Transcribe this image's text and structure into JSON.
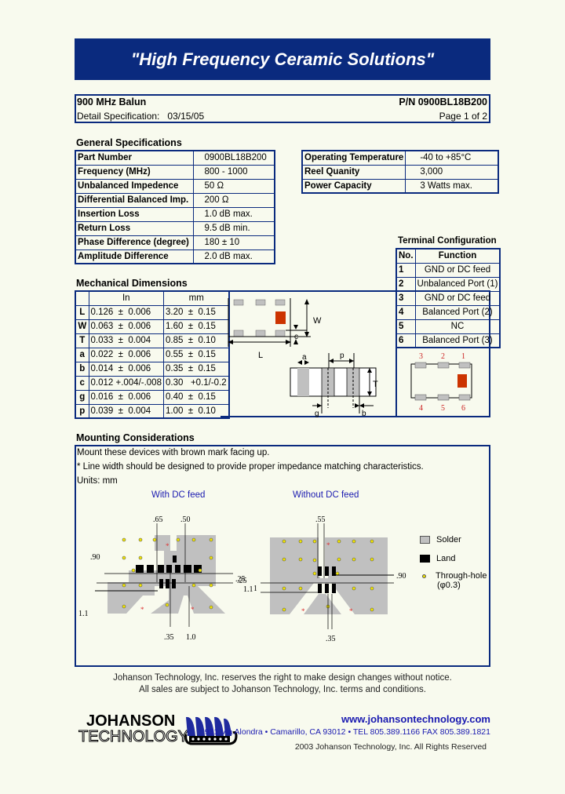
{
  "banner": {
    "title": "\"High Frequency Ceramic Solutions\""
  },
  "header": {
    "product": "900 MHz Balun",
    "part_number": "P/N 0900BL18B200",
    "spec_label": "Detail Specification:",
    "spec_date": "03/15/05",
    "page": "Page 1 of 2"
  },
  "general_specs": {
    "title": "General Specifications",
    "rows": [
      {
        "k": "Part Number",
        "v": "0900BL18B200"
      },
      {
        "k": "Frequency (MHz)",
        "v": "800 - 1000"
      },
      {
        "k": "Unbalanced Impedence",
        "v": "50 Ω"
      },
      {
        "k": "Differential Balanced Imp.",
        "v": "200 Ω"
      },
      {
        "k": "Insertion Loss",
        "v": "1.0 dB max."
      },
      {
        "k": "Return Loss",
        "v": "9.5 dB min."
      },
      {
        "k": "Phase Difference (degree)",
        "v": "180 ± 10"
      },
      {
        "k": "Amplitude Difference",
        "v": "2.0 dB max."
      }
    ],
    "other_rows": [
      {
        "k": "Operating Temperature",
        "v": "-40 to +85°C"
      },
      {
        "k": "Reel Quanity",
        "v": "3,000"
      },
      {
        "k": "Power Capacity",
        "v": "3 Watts max."
      }
    ]
  },
  "mechanical": {
    "title": "Mechanical Dimensions",
    "col_in": "In",
    "col_mm": "mm",
    "rows": [
      {
        "l": "L",
        "in": "0.126  ±  0.006",
        "mm": "3.20  ±  0.15"
      },
      {
        "l": "W",
        "in": "0.063  ±  0.006",
        "mm": "1.60  ±  0.15"
      },
      {
        "l": "T",
        "in": "0.033  ±  0.004",
        "mm": "0.85  ±  0.10"
      },
      {
        "l": "a",
        "in": "0.022  ±  0.006",
        "mm": "0.55  ±  0.15"
      },
      {
        "l": "b",
        "in": "0.014  ±  0.006",
        "mm": "0.35  ±  0.15"
      },
      {
        "l": "c",
        "in": "0.012 +.004/-.008",
        "mm": "0.30   +0.1/-0.2"
      },
      {
        "l": "g",
        "in": "0.016  ±  0.006",
        "mm": "0.40  ±  0.15"
      },
      {
        "l": "p",
        "in": "0.039  ±  0.004",
        "mm": "1.00  ±  0.10"
      }
    ],
    "diagram_labels": {
      "W": "W",
      "c": "c",
      "L": "L",
      "a": "a",
      "p": "p",
      "T": "T",
      "g": "g",
      "b": "b"
    }
  },
  "terminal": {
    "title": "Terminal Configuration",
    "col_no": "No.",
    "col_fn": "Function",
    "rows": [
      {
        "no": "1",
        "fn": "GND or DC feed"
      },
      {
        "no": "2",
        "fn": "Unbalanced Port (1)"
      },
      {
        "no": "3",
        "fn": "GND or DC feed"
      },
      {
        "no": "4",
        "fn": "Balanced Port (2)"
      },
      {
        "no": "5",
        "fn": "NC"
      },
      {
        "no": "6",
        "fn": "Balanced Port (3)"
      }
    ],
    "pin_top": [
      "3",
      "2",
      "1"
    ],
    "pin_bottom": [
      "4",
      "5",
      "6"
    ]
  },
  "mounting": {
    "title": "Mounting Considerations",
    "lines": [
      "Mount these devices with brown mark facing up.",
      "* Line width should be designed to provide proper impedance matching characteristics.",
      "Units: mm"
    ],
    "with_dc": "With DC feed",
    "without_dc": "Without DC feed",
    "dims_with": {
      "d065": ".65",
      "d050": ".50",
      "d090": ".90",
      "d025": ".25",
      "d11a": "1.1",
      "d11b": "1.1",
      "d035": ".35",
      "d10": "1.0"
    },
    "dims_without": {
      "d065": ".55",
      "d025": ".25",
      "d11": "1.1",
      "d090": ".90",
      "d035": ".35"
    },
    "legend": {
      "solder": "Solder",
      "land": "Land",
      "through": "Through-hole",
      "through2": "(φ0.3)"
    }
  },
  "footer": {
    "line1": "Johanson Technology, Inc. reserves the right to make design changes without notice.",
    "line2": "All sales are subject to Johanson Technology, Inc. terms and conditions.",
    "logo_top": "JOHANSON",
    "logo_bottom": "TECHNOLOGY",
    "url": "www.johansontechnology.com",
    "address": "931 Via Alondra • Camarillo, CA 93012 • TEL 805.389.1166 FAX 805.389.1821",
    "copyright": "2003 Johanson Technology, Inc.  All Rights Reserved"
  },
  "colors": {
    "navy": "#0a2a7e",
    "background": "#f8faee",
    "brown_mark": "#cc3300",
    "solder": "#c0c0c0",
    "via": "#f2e600",
    "link_blue": "#1a1ab0"
  }
}
